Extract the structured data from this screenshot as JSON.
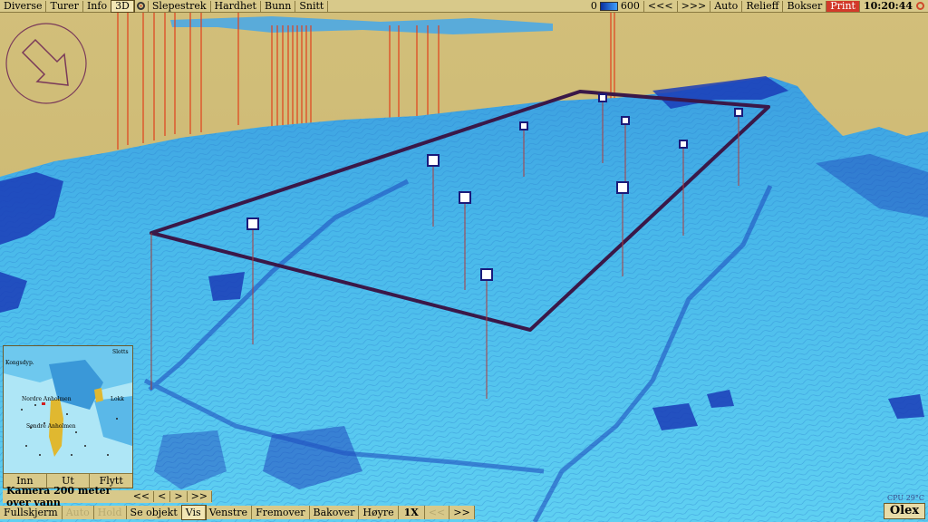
{
  "topbar": {
    "left_buttons": [
      "Diverse",
      "Turer",
      "Info",
      "3D"
    ],
    "active_button": "3D",
    "right_left_buttons": [
      "Slepestrek",
      "Hardhet",
      "Bunn",
      "Snitt"
    ],
    "scale_min": "0",
    "scale_max": "600",
    "nav_buttons": [
      "<<<",
      ">>>",
      "Auto",
      "Relieff",
      "Bokser"
    ],
    "print_label": "Print",
    "clock": "10:20:44"
  },
  "minimap": {
    "labels": [
      "Nordre Anholmen",
      "Søndre Anholmen",
      "Lokk",
      "Slotts",
      "Kongsdyp."
    ],
    "buttons": [
      "Inn",
      "Ut",
      "Flytt"
    ]
  },
  "camera": {
    "label": "Kamera 200 meter over vann",
    "buttons": [
      "<<",
      "<",
      ">",
      ">>"
    ]
  },
  "bottombar": {
    "buttons": [
      "Fullskjerm",
      "Auto",
      "Hold",
      "Se objekt",
      "Vis",
      "Venstre",
      "Fremover",
      "Bakover",
      "Høyre",
      "1X",
      "<<",
      ">>"
    ],
    "active": "Vis"
  },
  "status": {
    "cpu": "CPU 29°C",
    "brand": "Olex"
  },
  "colors": {
    "sky": "#cbb873",
    "seabed_light": "#4fc3ec",
    "seabed_dark": "#1230a8",
    "survey_box": "#3a1848",
    "sonar_lines": "#e0401c"
  },
  "icons": {
    "compass": "direction-arrow-icon",
    "sun": "sun-icon"
  }
}
